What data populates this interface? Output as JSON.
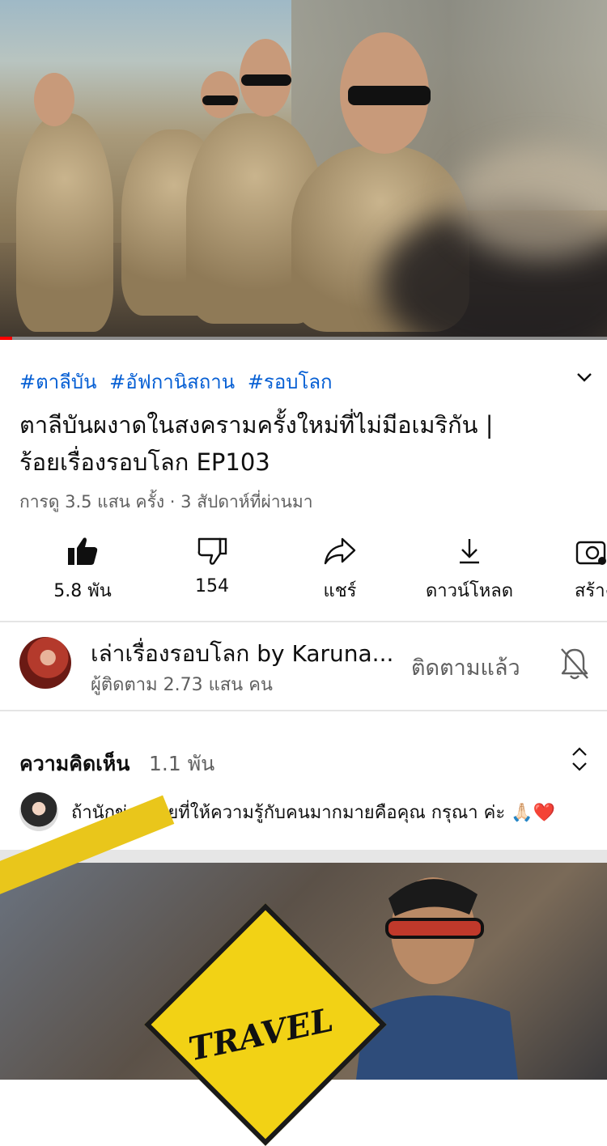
{
  "video": {
    "hashtags": [
      "#ตาลีบัน",
      "#อัฟกานิสถาน",
      "#รอบโลก"
    ],
    "title_line1": "ตาลีบันผงาดในสงครามครั้งใหม่ที่ไม่มีอเมริกัน |",
    "title_line2": "ร้อยเรื่องรอบโลก EP103",
    "meta": "การดู 3.5 แสน ครั้ง · 3 สัปดาห์ที่ผ่านมา",
    "progress": 0.02
  },
  "actions": [
    {
      "label": "5.8 พัน",
      "icon": "thumbs-up-icon"
    },
    {
      "label": "154",
      "icon": "thumbs-down-icon"
    },
    {
      "label": "แชร์",
      "icon": "share-icon"
    },
    {
      "label": "ดาวน์โหลด",
      "icon": "download-icon"
    },
    {
      "label": "สร้าง",
      "icon": "create-clip-icon"
    }
  ],
  "channel": {
    "name": "เล่าเรื่องรอบโลก by Karuna...",
    "subscribers": "ผู้ติดตาม 2.73 แสน คน",
    "subscribe_state": "ติดตามแล้ว"
  },
  "comments": {
    "heading": "ความคิดเห็น",
    "count": "1.1 พัน",
    "top_comment": "ถ้านักข่าวไทยที่ให้ความรู้กับคนมากมายคือคุณ กรุณา ค่ะ 🙏🏻❤️"
  },
  "next_video": {
    "sign_text": "TRAVEL"
  },
  "colors": {
    "hashtag": "#065fd4",
    "progress_played": "#ff0000",
    "secondary_text": "#606060"
  }
}
